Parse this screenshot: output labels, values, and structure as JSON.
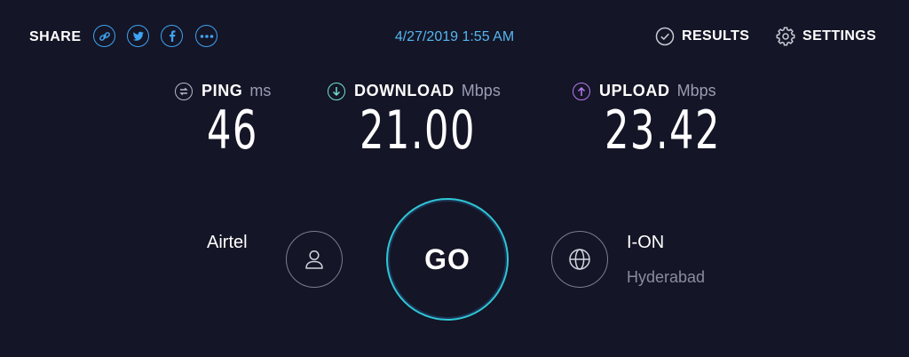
{
  "header": {
    "share_label": "SHARE",
    "share_buttons": [
      {
        "icon": "link-icon"
      },
      {
        "icon": "twitter-icon"
      },
      {
        "icon": "facebook-icon"
      },
      {
        "icon": "more-icon"
      }
    ],
    "datetime": "4/27/2019 1:55 AM",
    "results_label": "RESULTS",
    "settings_label": "SETTINGS"
  },
  "metrics": {
    "ping": {
      "label": "PING",
      "unit": "ms",
      "value": "46"
    },
    "download": {
      "label": "DOWNLOAD",
      "unit": "Mbps",
      "value": "21.00"
    },
    "upload": {
      "label": "UPLOAD",
      "unit": "Mbps",
      "value": "23.42"
    }
  },
  "isp": {
    "name": "Airtel"
  },
  "go_label": "GO",
  "server": {
    "name": "I-ON",
    "location": "Hyderabad"
  },
  "colors": {
    "background": "#141526",
    "share_accent": "#3fa3f2",
    "download_accent": "#6fe0d0",
    "upload_accent": "#b77cf2",
    "go_ring": "#2fc7d6"
  }
}
